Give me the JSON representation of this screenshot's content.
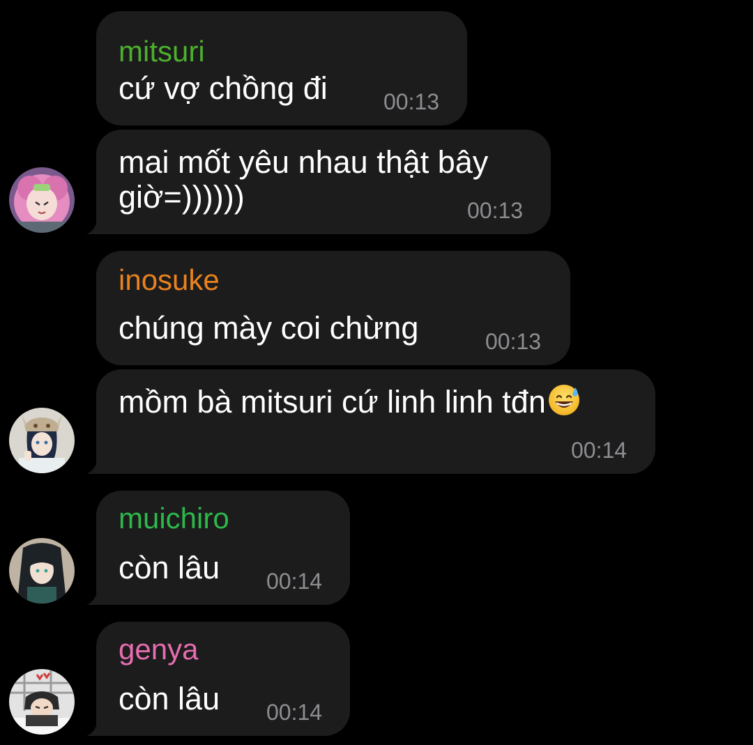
{
  "colors": {
    "background": "#000000",
    "bubble": "#1c1c1d",
    "time": "#8e8e92",
    "mitsuri": "#4caf2d",
    "inosuke": "#e8821e",
    "muichiro": "#2db84a",
    "genya": "#e76db0"
  },
  "messages": [
    {
      "sender": "mitsuri",
      "text": "cứ vợ chồng đi",
      "time": "00:13"
    },
    {
      "text_line1": "mai mốt yêu nhau thật bây",
      "text_line2": "giờ=))))))",
      "time": "00:13",
      "avatar_icon": "mitsuri-avatar"
    },
    {
      "sender": "inosuke",
      "text": "chúng mày coi chừng",
      "time": "00:13"
    },
    {
      "text": "mồm bà mitsuri cứ linh linh tđn",
      "emoji": "grinning-face-with-sweat",
      "time": "00:14",
      "avatar_icon": "inosuke-avatar"
    },
    {
      "sender": "muichiro",
      "text": "còn lâu",
      "time": "00:14",
      "avatar_icon": "muichiro-avatar"
    },
    {
      "sender": "genya",
      "text": "còn lâu",
      "time": "00:14",
      "avatar_icon": "genya-avatar"
    }
  ]
}
